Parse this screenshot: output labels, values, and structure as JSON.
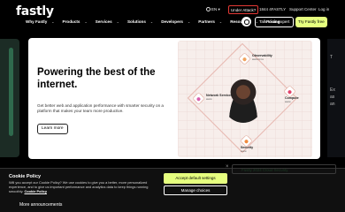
{
  "brand": {
    "logo": "fastly"
  },
  "utility": {
    "language": "EN",
    "attack_link": "Under Attack?",
    "phone": "1844 4FASTLY",
    "support": "Support Center",
    "login": "Log in"
  },
  "nav": {
    "items": [
      {
        "label": "Why Fastly"
      },
      {
        "label": "Products"
      },
      {
        "label": "Services"
      },
      {
        "label": "Solutions"
      },
      {
        "label": "Developers"
      },
      {
        "label": "Partners"
      },
      {
        "label": "Resources"
      },
      {
        "label": "Pricing"
      }
    ],
    "expert_button": "Talk to an expert",
    "try_button": "Try Fastly free"
  },
  "hero": {
    "title": "Powering the best of the internet.",
    "description": "Get better web and application performance with smarter security on a platform that makes your team more productive.",
    "cta": "Learn more",
    "nodes": [
      {
        "title": "Observability",
        "sub": "www.rc.ts",
        "color": "#f0a35e"
      },
      {
        "title": "Network Services",
        "sub": "www",
        "color": "#d85fae"
      },
      {
        "title": "Compute",
        "sub": "www",
        "color": "#e3436b"
      },
      {
        "title": "Security",
        "sub": "www",
        "color": "#f08a3e"
      }
    ]
  },
  "side_right": {
    "lines": [
      "T",
      "Ex",
      "as",
      "an"
    ]
  },
  "cookie": {
    "title": "Cookie Policy",
    "text": "Will you accept our Cookie Policy? We use cookies to give you a better, more personalized experience, and to give us important performance and analytics data to keep things running smoothly.",
    "link": "Cookie Policy",
    "accept": "Accept default settings",
    "manage": "Manage choices",
    "right_headline": "Fastly 2024 Cloud Security"
  },
  "footer": {
    "announcements": "More announcements"
  }
}
